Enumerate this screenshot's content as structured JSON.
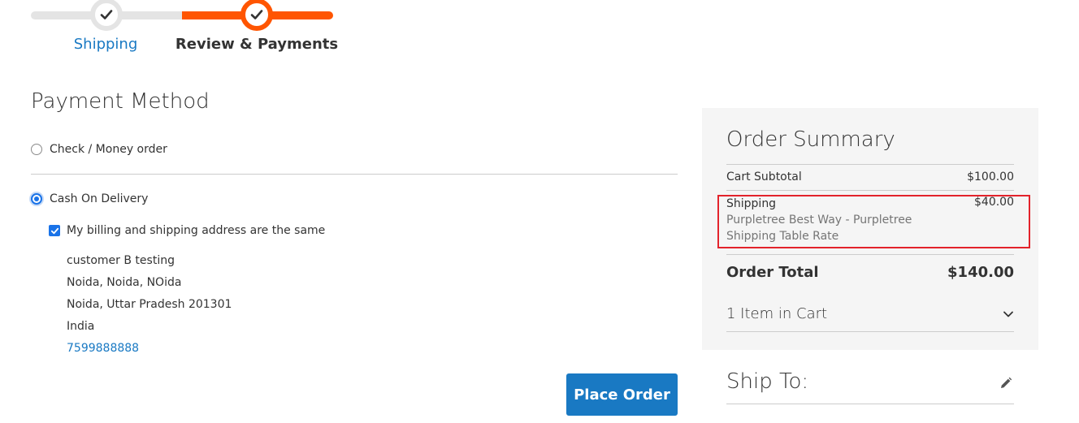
{
  "progress": {
    "steps": [
      {
        "label": "Shipping",
        "status": "complete"
      },
      {
        "label": "Review & Payments",
        "status": "active"
      }
    ],
    "colors": {
      "active": "#ff5501",
      "inactive": "#e4e4e4",
      "link": "#1979c3"
    }
  },
  "payment": {
    "title": "Payment Method",
    "methods": [
      {
        "label": "Check / Money order",
        "selected": false
      },
      {
        "label": "Cash On Delivery",
        "selected": true
      }
    ],
    "same_address_label": "My billing and shipping address are the same",
    "same_address_checked": true,
    "address": {
      "name": "customer B testing",
      "line1": "Noida, Noida, NOida",
      "line2": "Noida, Uttar Pradesh 201301",
      "country": "India",
      "phone": "7599888888"
    },
    "place_order_label": "Place Order"
  },
  "summary": {
    "title": "Order Summary",
    "subtotal_label": "Cart Subtotal",
    "subtotal_value": "$100.00",
    "shipping_label": "Shipping",
    "shipping_method": "Purpletree Best Way - Purpletree Shipping Table Rate",
    "shipping_value": "$40.00",
    "total_label": "Order Total",
    "total_value": "$140.00",
    "items_label": "1 Item in Cart",
    "highlight_color": "#e3232b"
  },
  "ship_to": {
    "title": "Ship To:",
    "edit_icon": "pencil-icon"
  }
}
